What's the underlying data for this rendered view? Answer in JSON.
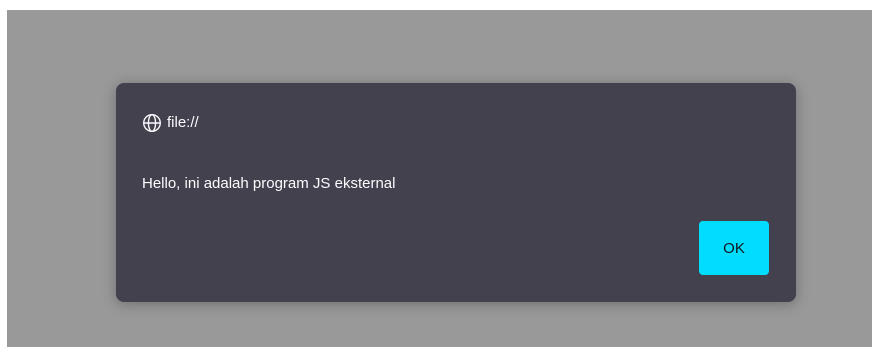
{
  "dialog": {
    "origin_icon": "globe-icon",
    "origin": "file://",
    "message": "Hello, ini adalah program JS eksternal",
    "ok_label": "OK"
  },
  "colors": {
    "backdrop": "#999999",
    "dialog_background": "#42414d",
    "dialog_text": "#fbfbfe",
    "ok_button": "#00ddff"
  }
}
